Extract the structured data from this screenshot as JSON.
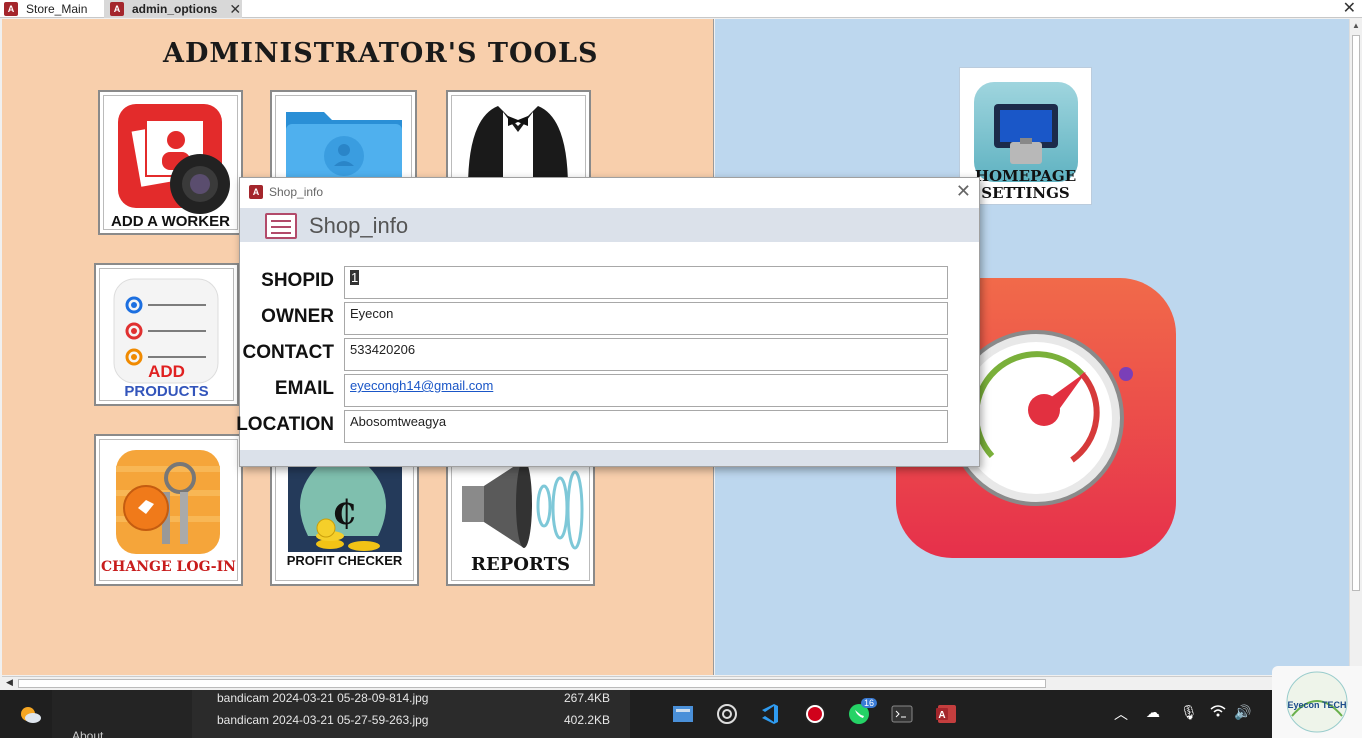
{
  "tabs": [
    {
      "label": "Store_Main",
      "active": false
    },
    {
      "label": "admin_options",
      "active": true
    }
  ],
  "window": {
    "close_glyph": "✕"
  },
  "admin": {
    "title": "ADMINISTRATOR'S TOOLS",
    "tiles": {
      "add_worker": "ADD A WORKER",
      "add_products_line1": "ADD",
      "add_products_line2": "PRODUCTS",
      "change_login": "CHANGE LOG-IN",
      "profit_checker": "PROFIT CHECKER",
      "reports": "REPORTS"
    }
  },
  "right_pane": {
    "homepage_line1": "HOMEPAGE",
    "homepage_line2": "SETTINGS"
  },
  "dialog": {
    "window_title": "Shop_info",
    "header_title": "Shop_info",
    "fields": [
      {
        "label": "SHOPID",
        "value": "1"
      },
      {
        "label": "OWNER",
        "value": "Eyecon"
      },
      {
        "label": "CONTACT",
        "value": "533420206"
      },
      {
        "label": "EMAIL",
        "value": "eyecongh14@gmail.com"
      },
      {
        "label": "LOCATION",
        "value": "Abosomtweagya"
      }
    ]
  },
  "taskbar": {
    "files": [
      {
        "name": "bandicam 2024-03-21 05-28-09-814.jpg",
        "size": "267.4KB"
      },
      {
        "name": "bandicam 2024-03-21 05-27-59-263.jpg",
        "size": "402.2KB"
      }
    ],
    "about": "About",
    "whatsapp_badge": "16",
    "logo_text": "Eyecon TECH"
  },
  "colors": {
    "left_pane": "#f8cfac",
    "right_pane": "#bdd7ee",
    "access_red": "#a4262c"
  }
}
